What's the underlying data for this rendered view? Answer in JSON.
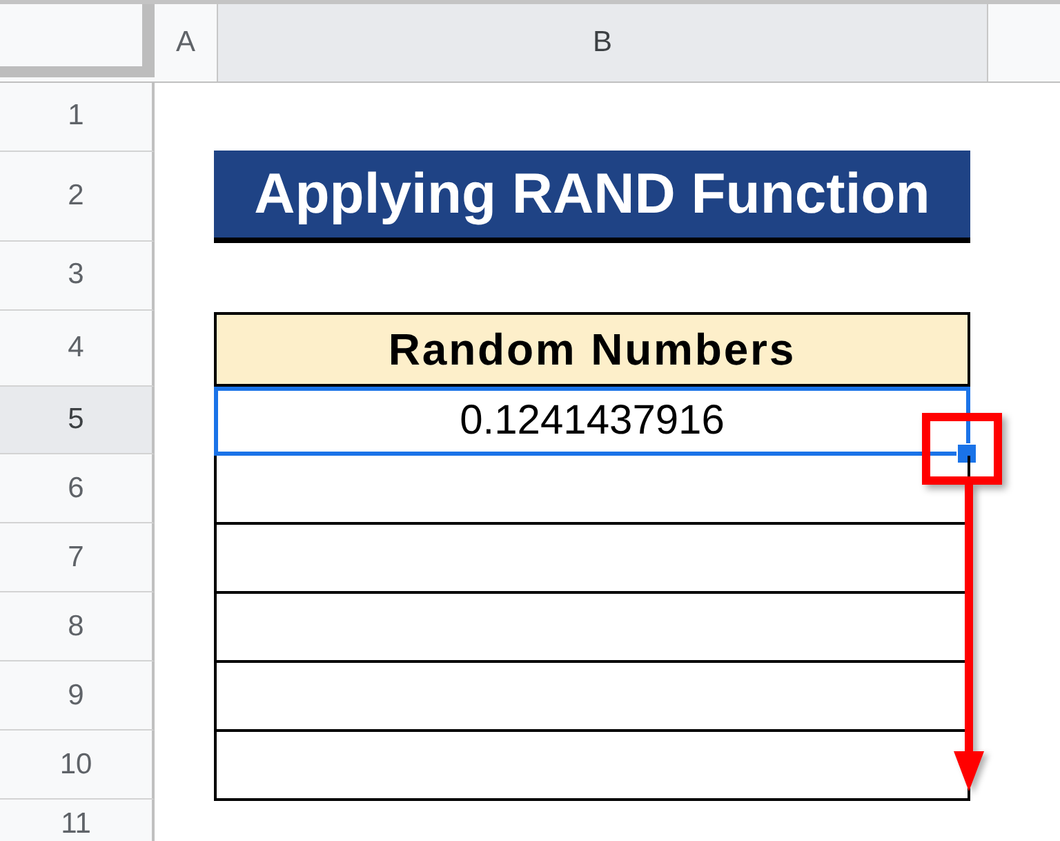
{
  "columns": [
    {
      "label": "A",
      "selected": false
    },
    {
      "label": "B",
      "selected": true
    }
  ],
  "rows": [
    {
      "label": "1",
      "selected": false
    },
    {
      "label": "2",
      "selected": false
    },
    {
      "label": "3",
      "selected": false
    },
    {
      "label": "4",
      "selected": false
    },
    {
      "label": "5",
      "selected": true
    },
    {
      "label": "6",
      "selected": false
    },
    {
      "label": "7",
      "selected": false
    },
    {
      "label": "8",
      "selected": false
    },
    {
      "label": "9",
      "selected": false
    },
    {
      "label": "10",
      "selected": false
    },
    {
      "label": "11",
      "selected": false
    }
  ],
  "title": "Applying RAND Function",
  "table": {
    "header": "Random Numbers",
    "rows": [
      {
        "value": "0.1241437916",
        "selected": true
      },
      {
        "selected": false
      },
      {
        "selected": false
      },
      {
        "selected": false
      },
      {
        "selected": false
      },
      {
        "selected": false
      }
    ]
  }
}
